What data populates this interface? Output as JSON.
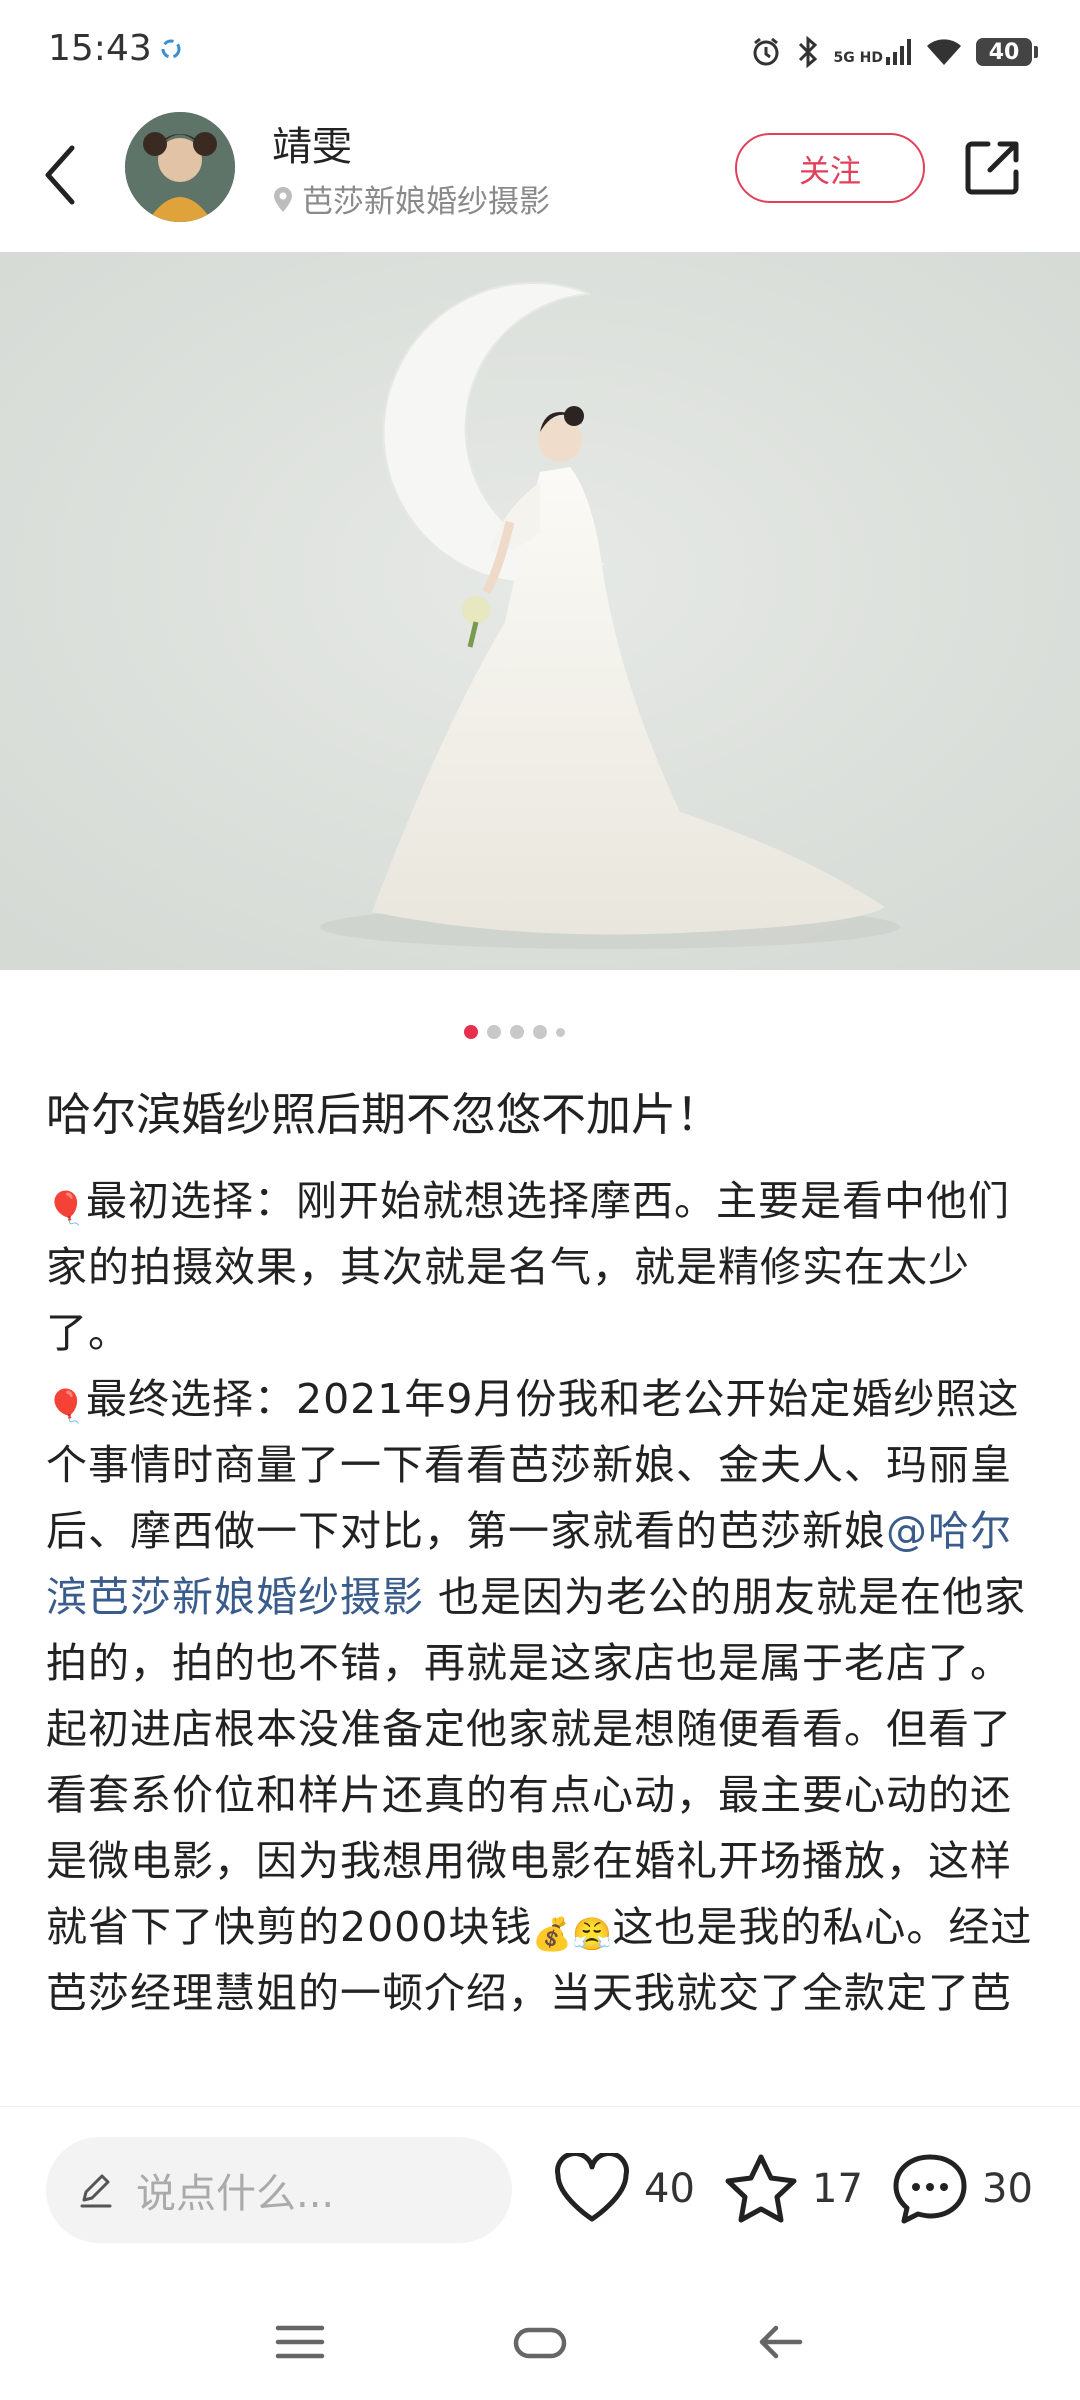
{
  "status_bar": {
    "time": "15:43",
    "network_top": "5G HD",
    "network_bottom": "",
    "battery": "40"
  },
  "header": {
    "author": "靖雯",
    "location": "芭莎新娘婚纱摄影",
    "follow_label": "关注"
  },
  "carousel": {
    "count": 5,
    "active_index": 0
  },
  "post": {
    "title": "哈尔滨婚纱照后期不忽悠不加片！",
    "p1_text": "最初选择：刚开始就想选择摩西。主要是看中他们家的拍摄效果，其次就是名气，就是精修实在太少了。",
    "p2_text": "最终选择：2021年9月份我和老公开始定婚纱照这个事情时商量了一下看看芭莎新娘、金夫人、玛丽皇后、摩西做一下对比，第一家就看的芭莎新娘",
    "mention": "@哈尔滨芭莎新娘婚纱摄影",
    "p2_tail": " 也是因为老公的朋友就是在他家拍的，拍的也不错，再就是这家店也是属于老店了。起初进店根本没准备定他家就是想随便看看。但看了看套系价位和样片还真的有点心动，最主要心动的还是微电影，因为我想用微电影在婚礼开场播放，这样就省下了快剪的2000块钱",
    "p2_end": "这也是我的私心。经过芭莎经理慧姐的一顿介绍，当天我就交了全款定了芭"
  },
  "bottom_bar": {
    "comment_placeholder": "说点什么...",
    "likes": "40",
    "favorites": "17",
    "comments": "30"
  },
  "colors": {
    "accent": "#e0405a",
    "mention": "#3a5c8c"
  }
}
